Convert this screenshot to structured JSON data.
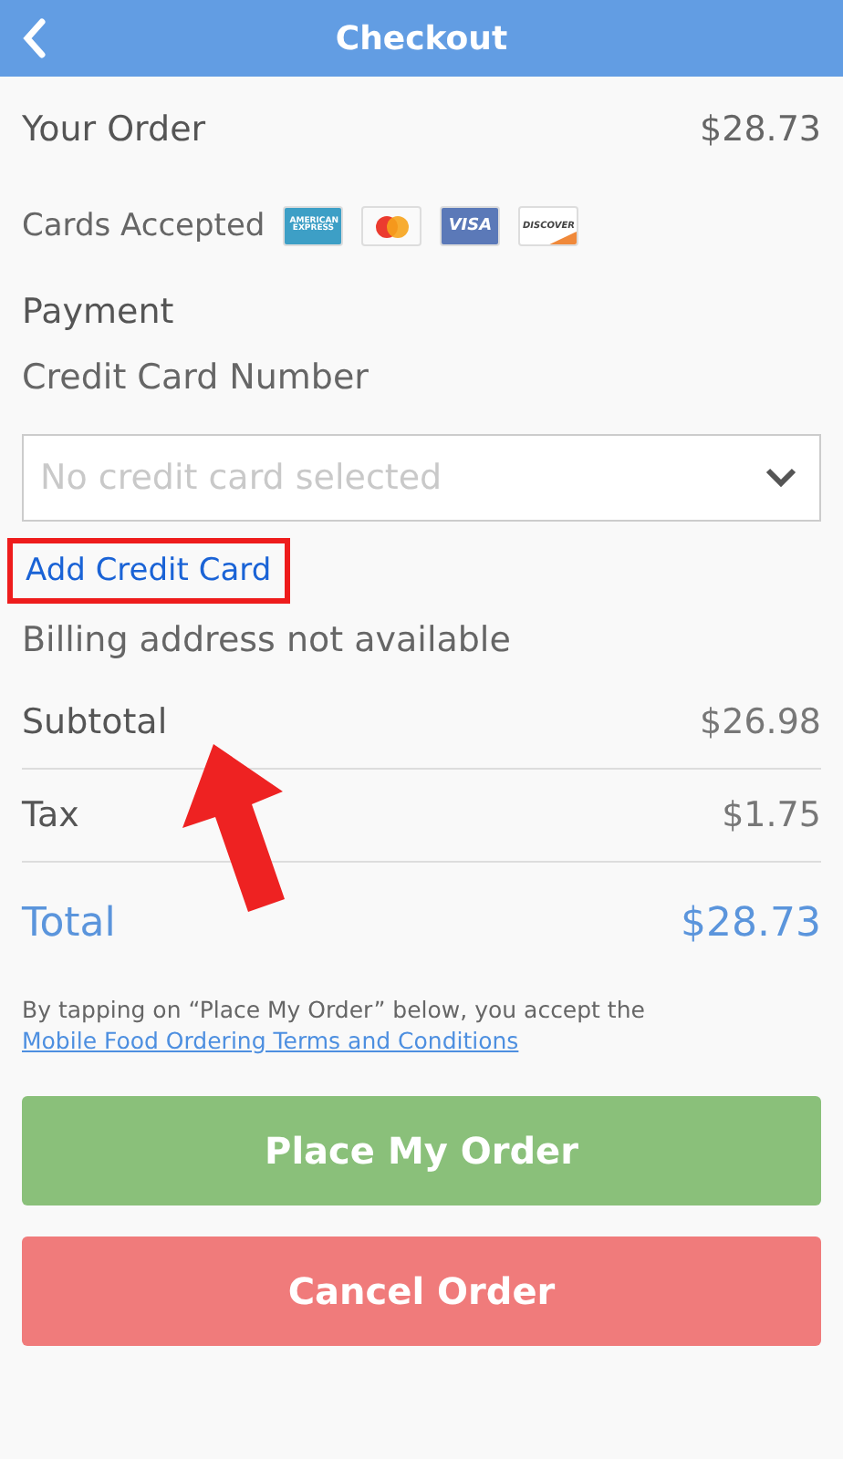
{
  "header": {
    "title": "Checkout"
  },
  "order": {
    "label": "Your Order",
    "amount": "$28.73"
  },
  "cards": {
    "label": "Cards Accepted",
    "items": [
      {
        "kind": "amex",
        "label": "AMERICAN EXPRESS"
      },
      {
        "kind": "mastercard"
      },
      {
        "kind": "visa",
        "label": "VISA"
      },
      {
        "kind": "discover",
        "label": "DISCOVER"
      }
    ]
  },
  "payment": {
    "title": "Payment",
    "field_label": "Credit Card Number",
    "select": {
      "placeholder": "No credit card selected"
    },
    "add_link": "Add Credit Card",
    "highlighted": true,
    "billing_note": "Billing address not available"
  },
  "summary": [
    {
      "kind": "line",
      "label": "Subtotal",
      "amount": "$26.98"
    },
    {
      "kind": "line",
      "label": "Tax",
      "amount": "$1.75"
    },
    {
      "kind": "total",
      "label": "Total",
      "amount": "$28.73"
    }
  ],
  "terms": {
    "text": "By tapping on “Place My Order” below, you accept the",
    "link": "Mobile Food Ordering Terms and Conditions"
  },
  "buttons": [
    {
      "kind": "primary",
      "label": "Place My Order"
    },
    {
      "kind": "danger",
      "label": "Cancel Order"
    }
  ]
}
